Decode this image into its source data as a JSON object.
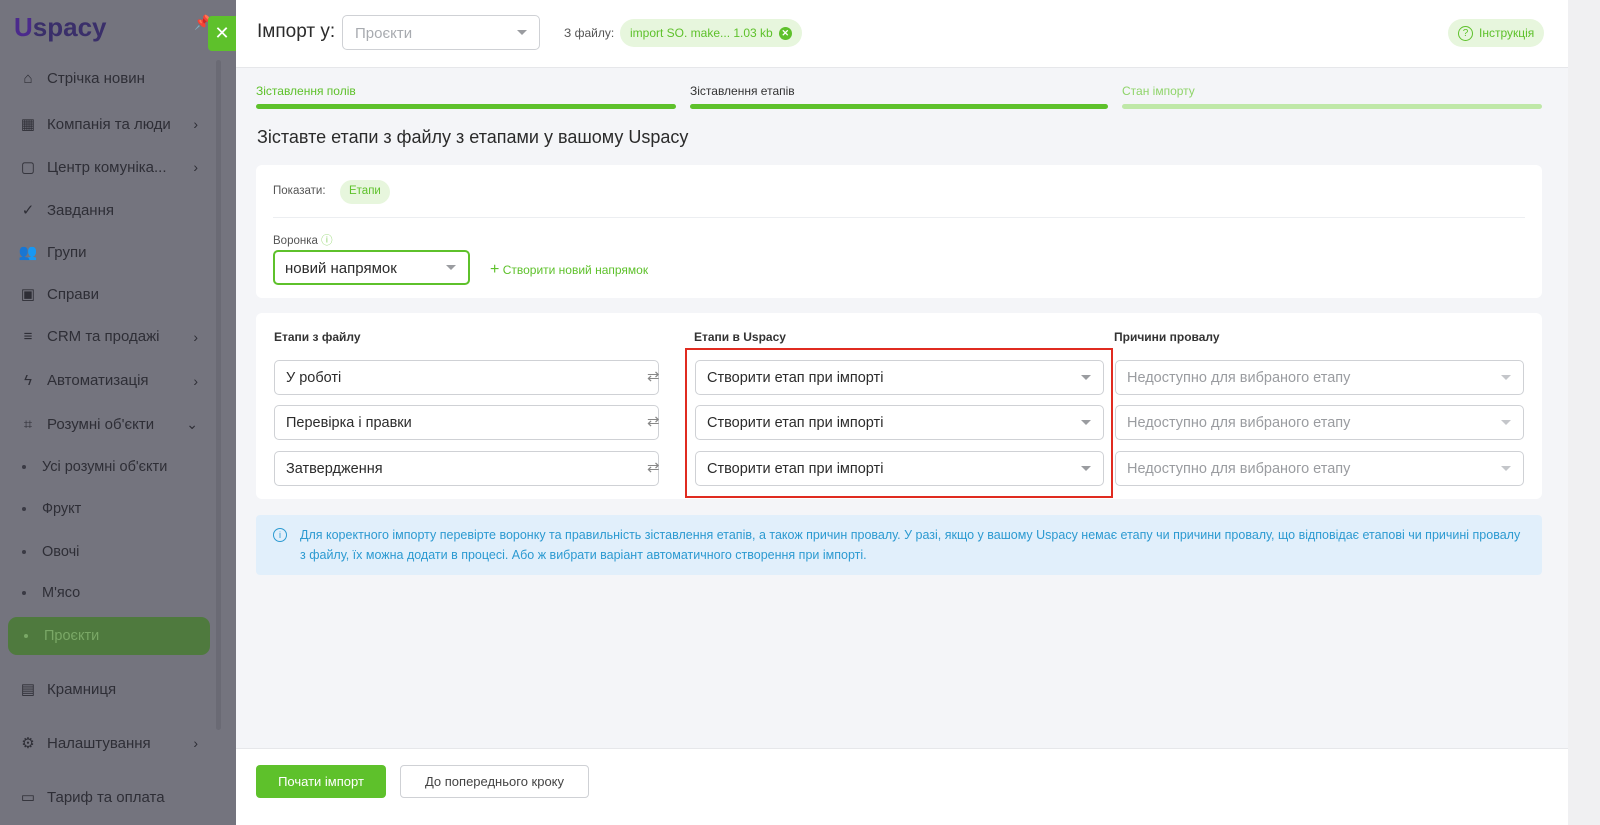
{
  "sidebar": {
    "logo": "Uspacy",
    "items": [
      {
        "label": "Стрічка новин",
        "icon": "home-icon"
      },
      {
        "label": "Компанія та люди",
        "icon": "building-icon",
        "chevron": true
      },
      {
        "label": "Центр комуніка...",
        "icon": "chat-icon",
        "chevron": true
      },
      {
        "label": "Завдання",
        "icon": "check-circle-icon"
      },
      {
        "label": "Групи",
        "icon": "users-icon"
      },
      {
        "label": "Справи",
        "icon": "calendar-icon"
      },
      {
        "label": "CRM та продажі",
        "icon": "database-icon",
        "chevron": true
      },
      {
        "label": "Автоматизація",
        "icon": "lightning-icon",
        "chevron": true
      },
      {
        "label": "Розумні об'єкти",
        "icon": "smart-objects-icon",
        "chevron": true,
        "expanded": true
      }
    ],
    "subitems": [
      "Усі розумні об'єкти",
      "Фрукт",
      "Овочі",
      "М'ясо",
      "Проєкти"
    ],
    "active_subitem": "Проєкти",
    "bottom_items": [
      {
        "label": "Крамниця",
        "icon": "store-icon"
      },
      {
        "label": "Налаштування",
        "icon": "gear-icon"
      },
      {
        "label": "Тариф та оплата",
        "icon": "wallet-icon"
      }
    ]
  },
  "header": {
    "title": "Імпорт у:",
    "target_placeholder": "Проєкти",
    "file_label": "З файлу:",
    "file_chip": "import SO. make... 1.03 kb",
    "instruction": "Інструкція"
  },
  "steps": [
    {
      "label": "Зіставлення полів",
      "state": "done"
    },
    {
      "label": "Зіставлення етапів",
      "state": "current"
    },
    {
      "label": "Стан імпорту",
      "state": "pending"
    }
  ],
  "page_title": "Зіставте етапи з файлу з етапами у вашому Uspacy",
  "filter": {
    "show_label": "Показати:",
    "show_chip": "Етапи",
    "funnel_label": "Воронка",
    "funnel_value": "новий напрямок",
    "create_funnel": "Створити новий напрямок"
  },
  "mapping": {
    "headers": [
      "Етапи з файлу",
      "Етапи в Uspacy",
      "Причини провалу"
    ],
    "rows": [
      {
        "file": "У роботі",
        "uspacy": "Створити етап при імпорті",
        "reason": "Недоступно для вибраного етапу"
      },
      {
        "file": "Перевірка і правки",
        "uspacy": "Створити етап при імпорті",
        "reason": "Недоступно для вибраного етапу"
      },
      {
        "file": "Затвердження",
        "uspacy": "Створити етап при імпорті",
        "reason": "Недоступно для вибраного етапу"
      }
    ]
  },
  "info": "Для коректного імпорту перевірте воронку та правильність зіставлення етапів, а також причин провалу. У разі, якщо у вашому Uspacy немає етапу чи причини провалу, що відповідає етапові чи причині провалу з файлу, їх можна додати в процесі. Або ж вибрати варіант автоматичного створення при імпорті.",
  "footer": {
    "start": "Почати імпорт",
    "back": "До попереднього кроку"
  },
  "colors": {
    "accent": "#5ec12b",
    "highlight": "#e02b20",
    "info": "#2c9ad1"
  }
}
